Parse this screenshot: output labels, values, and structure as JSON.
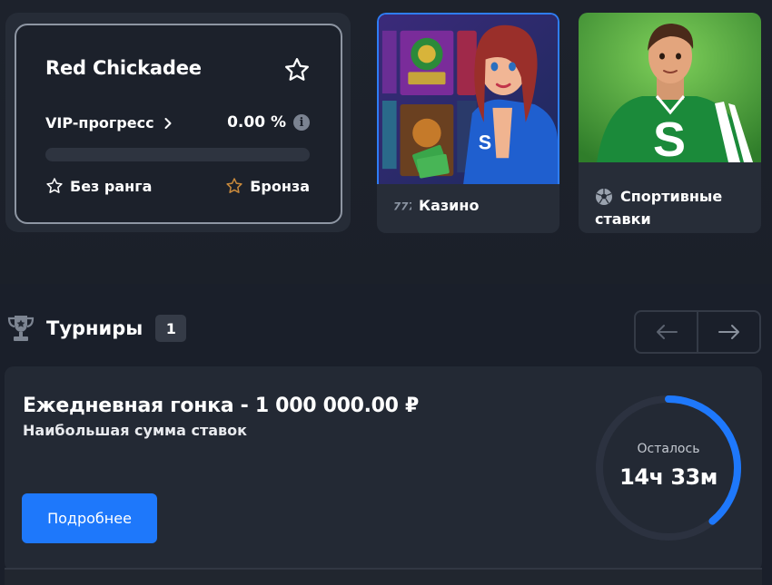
{
  "vip_card": {
    "username": "Red Chickadee",
    "progress_label": "VIP-прогресс",
    "progress_value": "0.00 %",
    "progress_fraction": 0,
    "current_rank": "Без ранга",
    "next_rank": "Бронза"
  },
  "promo_tiles": [
    {
      "label": "Казино",
      "icon": "casino-777-icon"
    },
    {
      "label_line1": "Спортивные",
      "label_line2": "ставки",
      "icon": "soccer-ball-icon"
    }
  ],
  "tournaments": {
    "title": "Турниры",
    "count": "1",
    "items": [
      {
        "name": "Ежедневная гонка - 1 000 000.00 ₽",
        "subtitle": "Наибольшая сумма ставок",
        "details_button": "Подробнее",
        "remaining_label": "Осталось",
        "remaining_value": "14ч 33м",
        "remaining_fraction": 0.39
      }
    ]
  },
  "colors": {
    "accent": "#1e78fb",
    "bronze": "#c98a3c",
    "page_bg": "#1a1f2a",
    "card_bg": "#232934"
  }
}
